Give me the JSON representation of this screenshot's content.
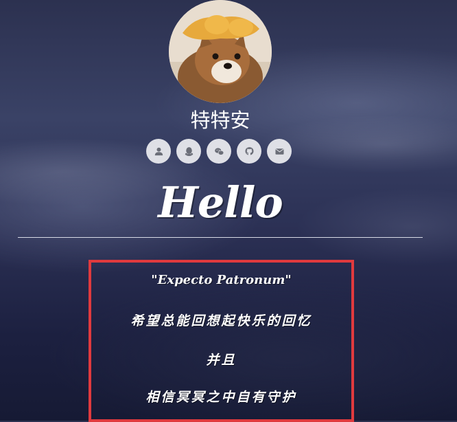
{
  "profile": {
    "name": "特特安",
    "avatar_icon": "dog-avatar-image"
  },
  "social_links": [
    {
      "icon": "user-icon",
      "label": "user"
    },
    {
      "icon": "qq-icon",
      "label": "qq"
    },
    {
      "icon": "wechat-icon",
      "label": "wechat"
    },
    {
      "icon": "github-icon",
      "label": "github"
    },
    {
      "icon": "mail-icon",
      "label": "email"
    }
  ],
  "hero": {
    "title": "Hello"
  },
  "quote": {
    "line1": "\"Expecto Patronum\"",
    "line2": "希望总能回想起快乐的回忆",
    "line3": "并且",
    "line4": "相信冥冥之中自有守护"
  },
  "colors": {
    "highlight_border": "#e03a3e",
    "icon_bg": "#dfe0e6",
    "icon_fg": "#6b6e78"
  }
}
